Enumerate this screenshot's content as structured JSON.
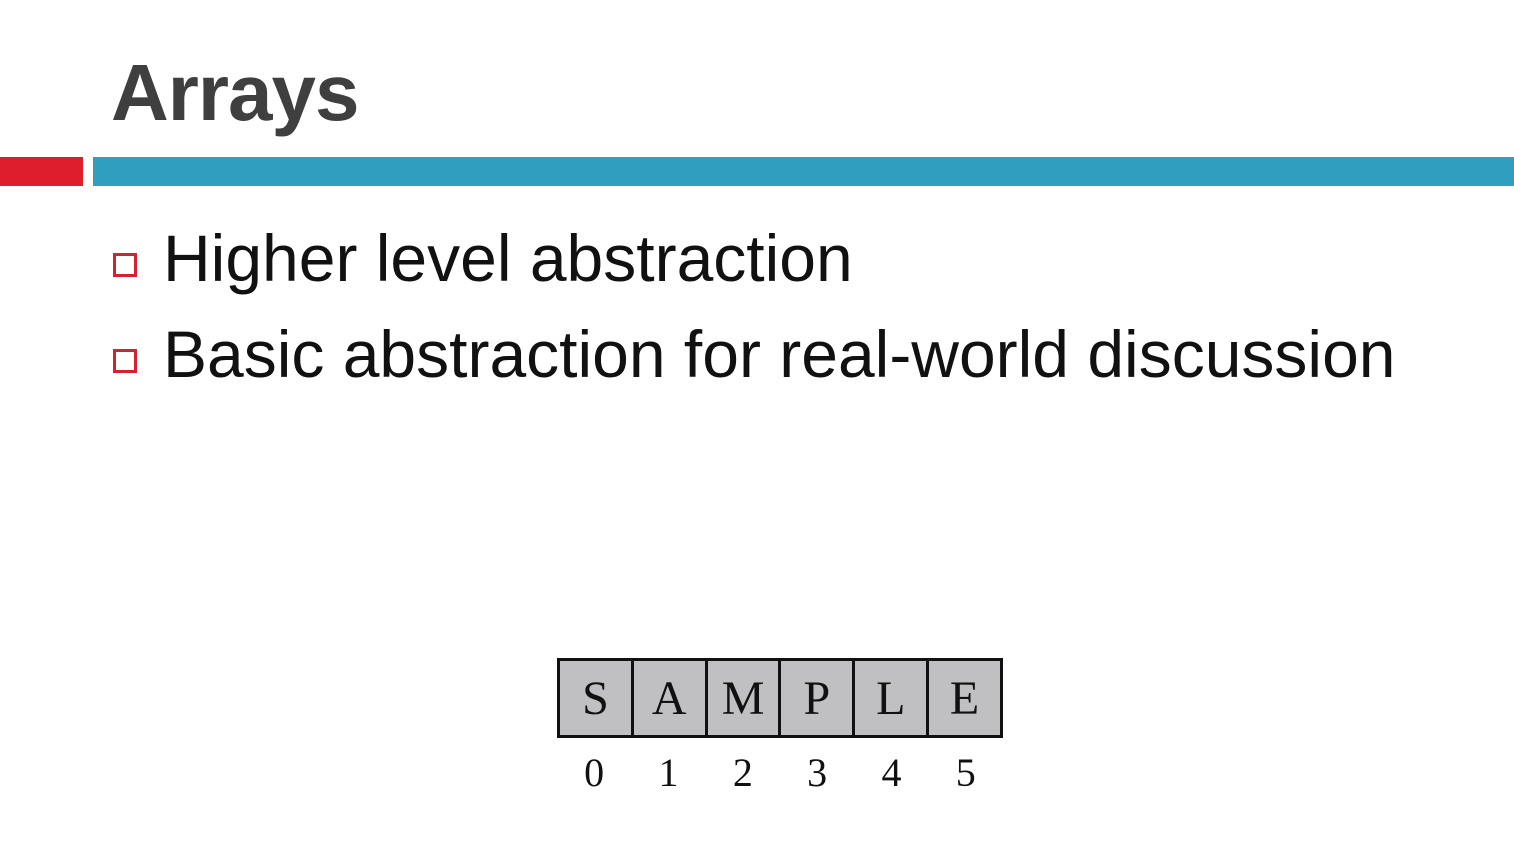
{
  "slide": {
    "title": "Arrays",
    "bullets": [
      "Higher level abstraction",
      "Basic abstraction for real-world discussion"
    ],
    "colors": {
      "title": "#3f3f3f",
      "accent_red": "#dd1f2d",
      "accent_blue": "#2f9fc0",
      "bullet_marker": "#d3232e",
      "cell_fill": "#c0bfc1"
    }
  },
  "array": {
    "cells": [
      "S",
      "A",
      "M",
      "P",
      "L",
      "E"
    ],
    "indices": [
      "0",
      "1",
      "2",
      "3",
      "4",
      "5"
    ]
  }
}
